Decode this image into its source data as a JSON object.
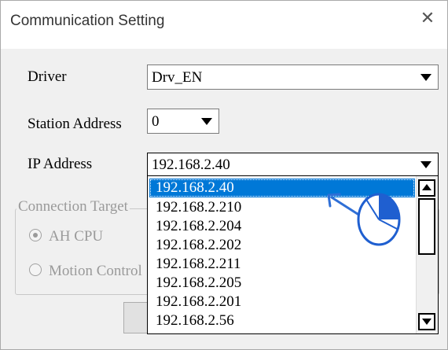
{
  "dialog": {
    "title": "Communication Setting",
    "close_glyph": "✕"
  },
  "driver": {
    "label": "Driver",
    "value": "Drv_EN"
  },
  "station": {
    "label": "Station Address",
    "value": "0"
  },
  "ip": {
    "label": "IP Address",
    "value": "192.168.2.40",
    "options": [
      "192.168.2.40",
      "192.168.2.210",
      "192.168.2.204",
      "192.168.2.202",
      "192.168.2.211",
      "192.168.2.205",
      "192.168.2.201",
      "192.168.2.56"
    ],
    "selected_index": 0
  },
  "connection_target": {
    "title": "Connection Target",
    "options": [
      {
        "label": "AH CPU",
        "checked": true
      },
      {
        "label": "Motion Control",
        "checked": false
      }
    ]
  },
  "annotation": {
    "icon": "mouse-click-icon",
    "arrow_color": "#2f6fd6"
  }
}
